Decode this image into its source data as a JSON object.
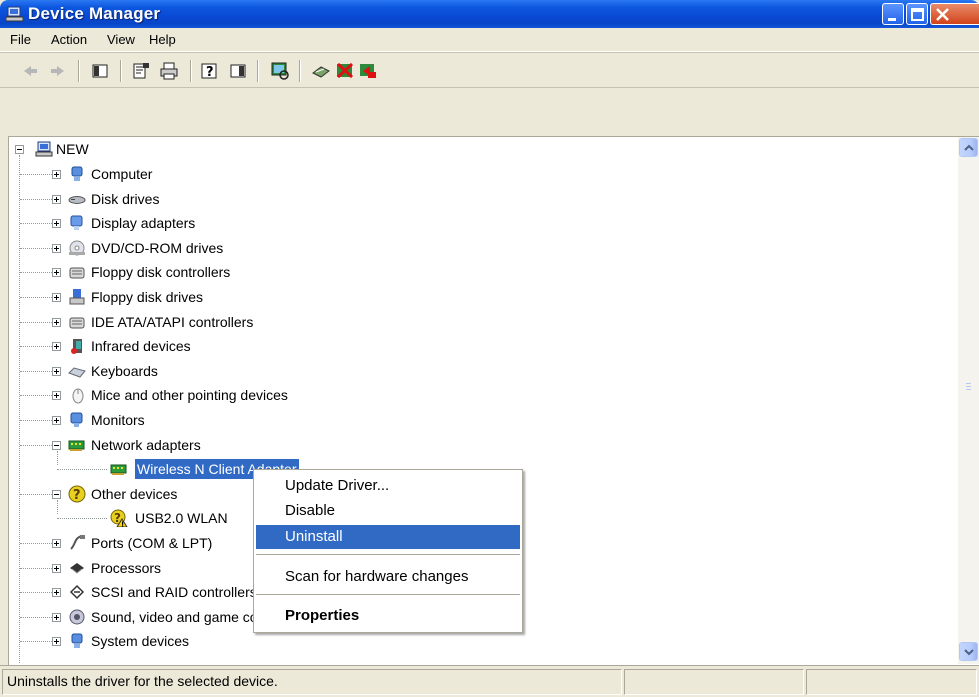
{
  "window": {
    "title": "Device Manager"
  },
  "menu": [
    "File",
    "Action",
    "View",
    "Help"
  ],
  "toolbar": {
    "buttons": [
      "back-icon",
      "forward-icon",
      "show-hide-console-tree-icon",
      "properties-icon",
      "print-icon",
      "help-icon",
      "show-hide-action-pane-icon",
      "scan-hardware-icon",
      "update-driver-icon",
      "disable-device-icon",
      "uninstall-device-icon"
    ]
  },
  "tree": {
    "root": "NEW",
    "nodes": [
      {
        "label": "Computer",
        "icon": "computer-icon",
        "expanded": false
      },
      {
        "label": "Disk drives",
        "icon": "disk-drive-icon",
        "expanded": false
      },
      {
        "label": "Display adapters",
        "icon": "display-adapter-icon",
        "expanded": false
      },
      {
        "label": "DVD/CD-ROM drives",
        "icon": "cd-rom-icon",
        "expanded": false
      },
      {
        "label": "Floppy disk controllers",
        "icon": "controller-icon",
        "expanded": false
      },
      {
        "label": "Floppy disk drives",
        "icon": "floppy-drive-icon",
        "expanded": false
      },
      {
        "label": "IDE ATA/ATAPI controllers",
        "icon": "controller-icon",
        "expanded": false
      },
      {
        "label": "Infrared devices",
        "icon": "infrared-icon",
        "expanded": false
      },
      {
        "label": "Keyboards",
        "icon": "keyboard-icon",
        "expanded": false
      },
      {
        "label": "Mice and other pointing devices",
        "icon": "mouse-icon",
        "expanded": false
      },
      {
        "label": "Monitors",
        "icon": "monitor-icon",
        "expanded": false
      },
      {
        "label": "Network adapters",
        "icon": "network-adapter-icon",
        "expanded": true
      },
      {
        "label": "Wireless N Client Adapter",
        "icon": "network-adapter-icon",
        "child": true,
        "selected": true
      },
      {
        "label": "Other devices",
        "icon": "unknown-device-icon",
        "expanded": true
      },
      {
        "label": "USB2.0 WLAN",
        "icon": "unknown-device-warning-icon",
        "child": true
      },
      {
        "label": "Ports (COM & LPT)",
        "icon": "port-icon",
        "expanded": false
      },
      {
        "label": "Processors",
        "icon": "processor-icon",
        "expanded": false
      },
      {
        "label": "SCSI and RAID controllers",
        "icon": "scsi-icon",
        "expanded": false
      },
      {
        "label": "Sound, video and game controllers",
        "icon": "sound-icon",
        "expanded": false
      },
      {
        "label": "System devices",
        "icon": "system-device-icon",
        "expanded": false
      }
    ]
  },
  "context_menu": {
    "items": [
      "Update Driver...",
      "Disable",
      "Uninstall",
      "Scan for hardware changes",
      "Properties"
    ],
    "highlighted": "Uninstall"
  },
  "status": {
    "text": "Uninstalls the driver for the selected device."
  },
  "colors": {
    "selection": "#316ac5",
    "titlebar": "#0a49d4",
    "face": "#ece9d8"
  }
}
